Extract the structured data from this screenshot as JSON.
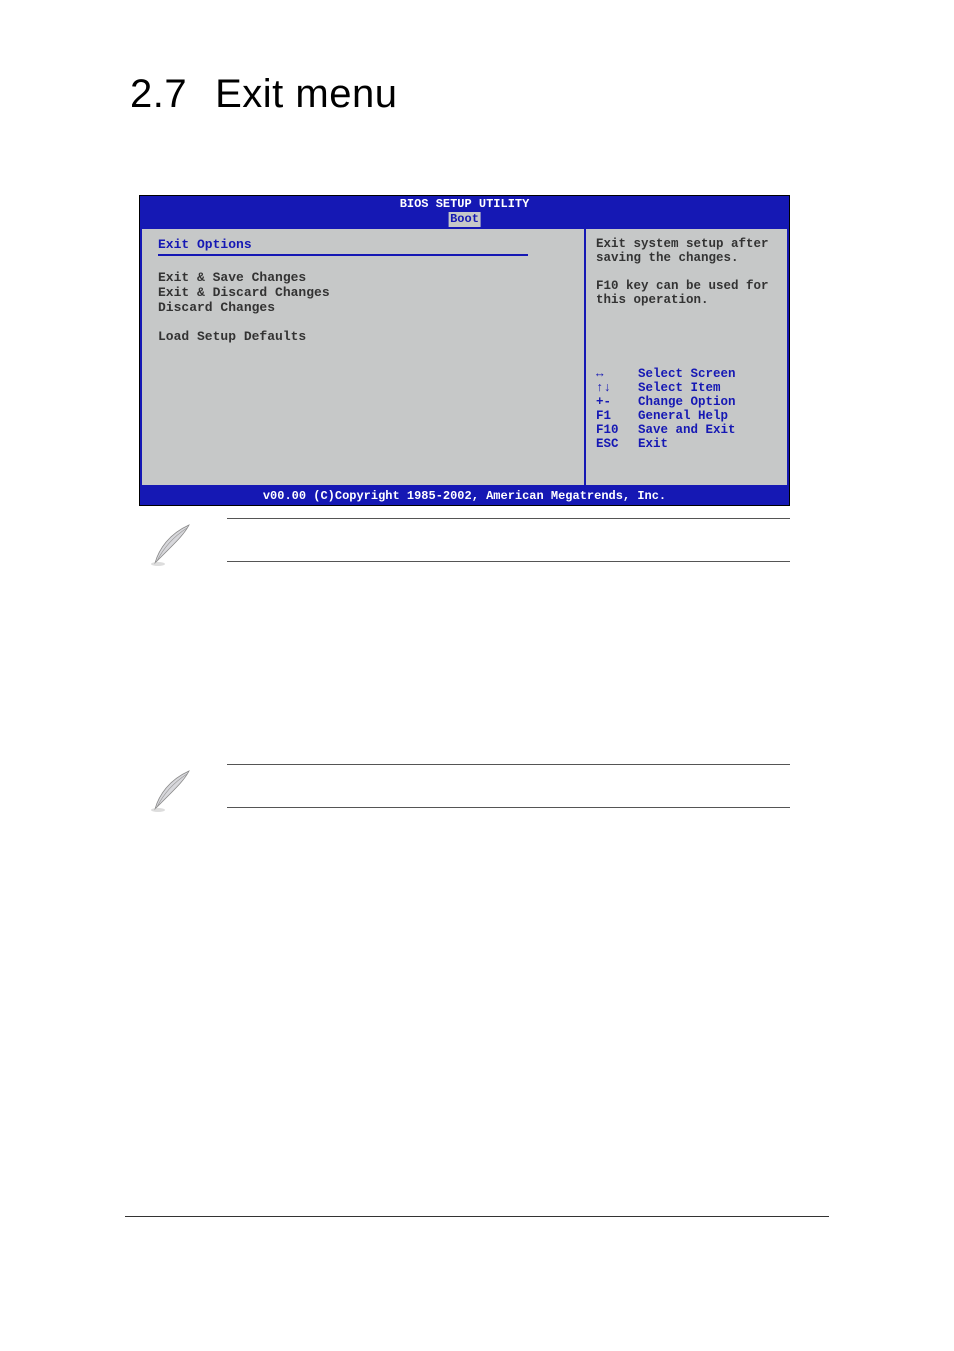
{
  "title": {
    "num": "2.7",
    "text": "Exit menu"
  },
  "bios": {
    "title": "BIOS SETUP UTILITY",
    "tab": "Boot",
    "section": "Exit Options",
    "items": [
      "Exit & Save Changes",
      "Exit & Discard Changes",
      "Discard Changes",
      "Load Setup Defaults"
    ],
    "help": {
      "p1": "Exit system setup after saving the changes.",
      "p2": "F10 key can be used for this operation."
    },
    "nav": [
      {
        "key": "↔",
        "label": "Select Screen"
      },
      {
        "key": "↑↓",
        "label": "Select Item"
      },
      {
        "key": "+-",
        "label": "Change Option"
      },
      {
        "key": "F1",
        "label": "General Help"
      },
      {
        "key": "F10",
        "label": "Save and Exit"
      },
      {
        "key": "ESC",
        "label": "Exit"
      }
    ],
    "footer": "v00.00 (C)Copyright 1985-2002, American Megatrends, Inc."
  }
}
